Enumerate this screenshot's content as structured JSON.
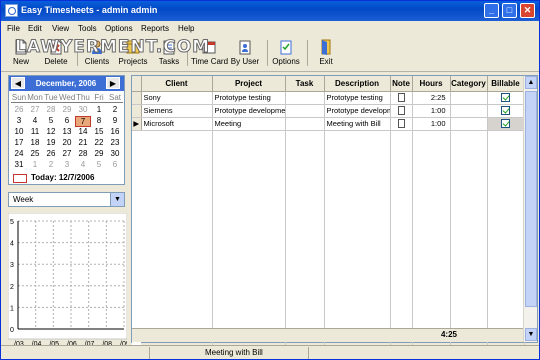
{
  "window": {
    "title": "Easy Timesheets - admin admin"
  },
  "watermark": "LAWYERMENT.COM",
  "menu": [
    "File",
    "Edit",
    "View",
    "Tools",
    "Options",
    "Reports",
    "Help"
  ],
  "toolbar": {
    "new": "New",
    "delete": "Delete",
    "clients": "Clients",
    "projects": "Projects",
    "tasks": "Tasks",
    "time_card": "Time Card",
    "by_user": "By User",
    "options": "Options",
    "exit": "Exit"
  },
  "calendar": {
    "month_label": "December, 2006",
    "day_names": [
      "Sun",
      "Mon",
      "Tue",
      "Wed",
      "Thu",
      "Fri",
      "Sat"
    ],
    "weeks": [
      [
        "26",
        "27",
        "28",
        "29",
        "30",
        "1",
        "2"
      ],
      [
        "3",
        "4",
        "5",
        "6",
        "7",
        "8",
        "9"
      ],
      [
        "10",
        "11",
        "12",
        "13",
        "14",
        "15",
        "16"
      ],
      [
        "17",
        "18",
        "19",
        "20",
        "21",
        "22",
        "23"
      ],
      [
        "24",
        "25",
        "26",
        "27",
        "28",
        "29",
        "30"
      ],
      [
        "31",
        "1",
        "2",
        "3",
        "4",
        "5",
        "6"
      ]
    ],
    "selected": "7",
    "today_label": "Today: 12/7/2006"
  },
  "period": {
    "selected": "Week"
  },
  "mini_chart": {
    "y_ticks": [
      "5",
      "4",
      "3",
      "2",
      "1",
      "0"
    ],
    "x_ticks": [
      "/03",
      "/04",
      "/05",
      "/06",
      "/07",
      "/08",
      "/09"
    ]
  },
  "grid": {
    "headers": [
      "Client",
      "Project",
      "Task",
      "Description",
      "Note",
      "Hours",
      "Category",
      "Billable"
    ],
    "rows": [
      {
        "client": "Sony",
        "project": "Prototype testing",
        "task": "",
        "description": "Prototype testing",
        "hours": "2:25",
        "category": ""
      },
      {
        "client": "Siemens",
        "project": "Prototype development",
        "task": "",
        "description": "Prototype development",
        "hours": "1:00",
        "category": ""
      },
      {
        "client": "Microsoft",
        "project": "Meeting",
        "task": "",
        "description": "Meeting with Bill",
        "hours": "1:00",
        "category": ""
      }
    ],
    "total_hours": "4:25"
  },
  "status": {
    "text": "Meeting with Bill"
  }
}
